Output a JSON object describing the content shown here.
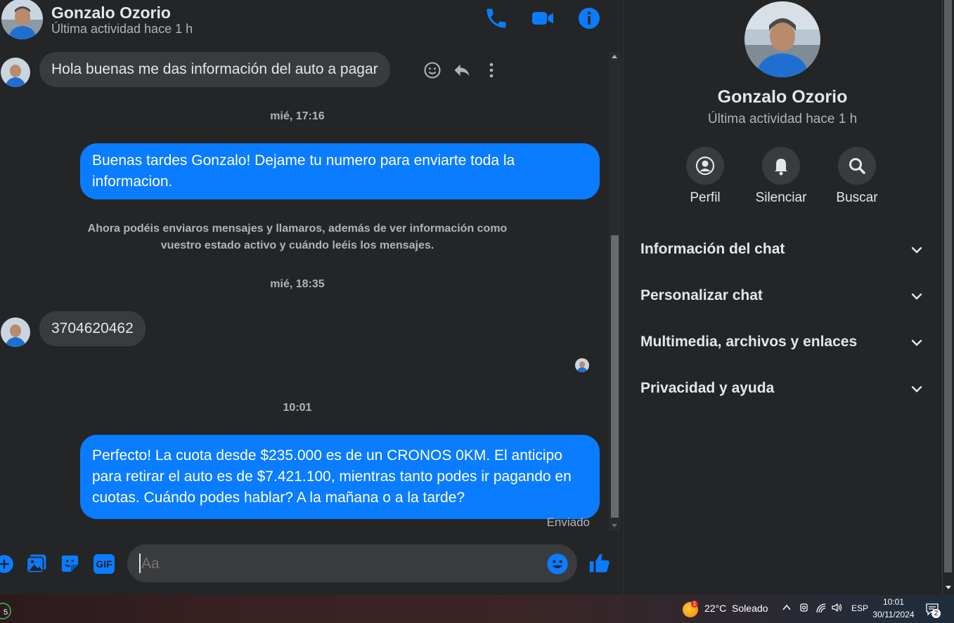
{
  "header": {
    "name": "Gonzalo Ozorio",
    "status": "Última actividad hace 1 h",
    "icons": [
      "phone-icon",
      "video-icon",
      "info-icon"
    ]
  },
  "messages": {
    "m1_text": "Hola buenas me das información del auto a pagar",
    "stamp1": "mié, 17:16",
    "m2_text": "Buenas tardes Gonzalo! Dejame tu numero para enviarte toda la informacion.",
    "system_text": "Ahora podéis enviaros mensajes y llamaros, además de ver información como vuestro estado activo y cuándo leéis los mensajes.",
    "stamp2": "mié, 18:35",
    "m3_text": "3704620462",
    "stamp3": "10:01",
    "m4_text": "Perfecto! La cuota desde $235.000 es de un CRONOS 0KM. El anticipo para retirar el auto es de $7.421.100, mientras tanto podes ir pagando en cuotas. Cuándo podes hablar? A la mañana o a la tarde?",
    "sent_label": "Enviado"
  },
  "composer": {
    "placeholder": "Aa",
    "icons": [
      "plus-icon",
      "image-icon",
      "sticker-icon",
      "gif-icon",
      "emoji-icon",
      "like-icon"
    ],
    "gif_label": "GIF"
  },
  "info": {
    "name": "Gonzalo Ozorio",
    "status": "Última actividad hace 1 h",
    "actions": [
      {
        "label": "Perfil",
        "icon": "profile-icon"
      },
      {
        "label": "Silenciar",
        "icon": "bell-icon"
      },
      {
        "label": "Buscar",
        "icon": "search-icon"
      }
    ],
    "sections": [
      {
        "label": "Información del chat"
      },
      {
        "label": "Personalizar chat"
      },
      {
        "label": "Multimedia, archivos y enlaces"
      },
      {
        "label": "Privacidad y ayuda"
      }
    ]
  },
  "taskbar": {
    "weather": "22°C  Soleado",
    "weather_badge": "1",
    "lang": "ESP",
    "time": "10:01",
    "date": "30/11/2024",
    "notif_count": "2",
    "left_badge": "5"
  },
  "colors": {
    "accent": "#0a7cff",
    "background": "#242526",
    "bubble_in": "#3a3b3c"
  }
}
